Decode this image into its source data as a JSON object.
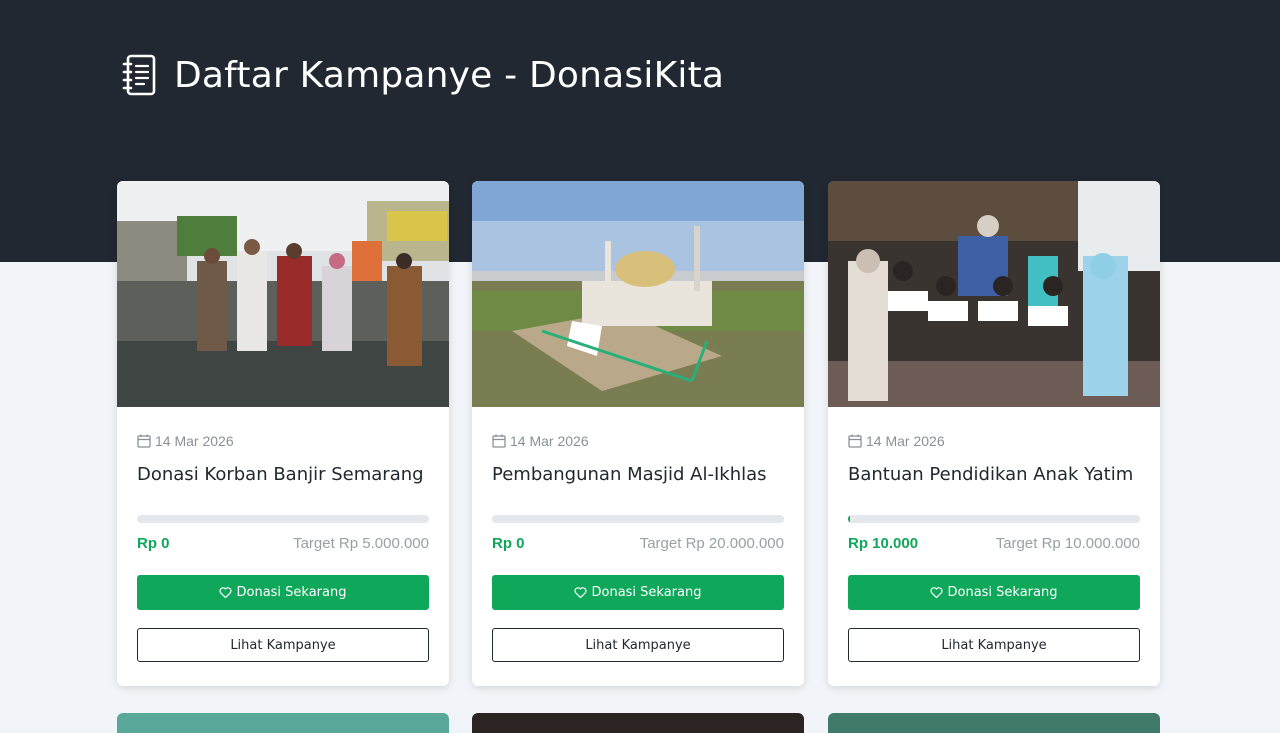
{
  "header": {
    "title": "Daftar Kampanye - DonasiKita",
    "icon": "notebook-icon",
    "background": "#222831"
  },
  "colors": {
    "accent": "#0fa85a",
    "page_bg": "#f1f4f8"
  },
  "campaigns": [
    {
      "image": "flood-photo",
      "date": "14 Mar 2026",
      "title": "Donasi Korban Banjir Semarang",
      "raised": "Rp 0",
      "target": "Target Rp 5.000.000",
      "progress": 0,
      "donate_label": "Donasi Sekarang",
      "view_label": "Lihat Kampanye"
    },
    {
      "image": "mosque-photo",
      "date": "14 Mar 2026",
      "title": "Pembangunan Masjid Al-Ikhlas",
      "raised": "Rp 0",
      "target": "Target Rp 20.000.000",
      "progress": 0,
      "donate_label": "Donasi Sekarang",
      "view_label": "Lihat Kampanye"
    },
    {
      "image": "orphans-photo",
      "date": "14 Mar 2026",
      "title": "Bantuan Pendidikan Anak Yatim",
      "raised": "Rp 10.000",
      "target": "Target Rp 10.000.000",
      "progress": 0.001,
      "donate_label": "Donasi Sekarang",
      "view_label": "Lihat Kampanye"
    }
  ]
}
